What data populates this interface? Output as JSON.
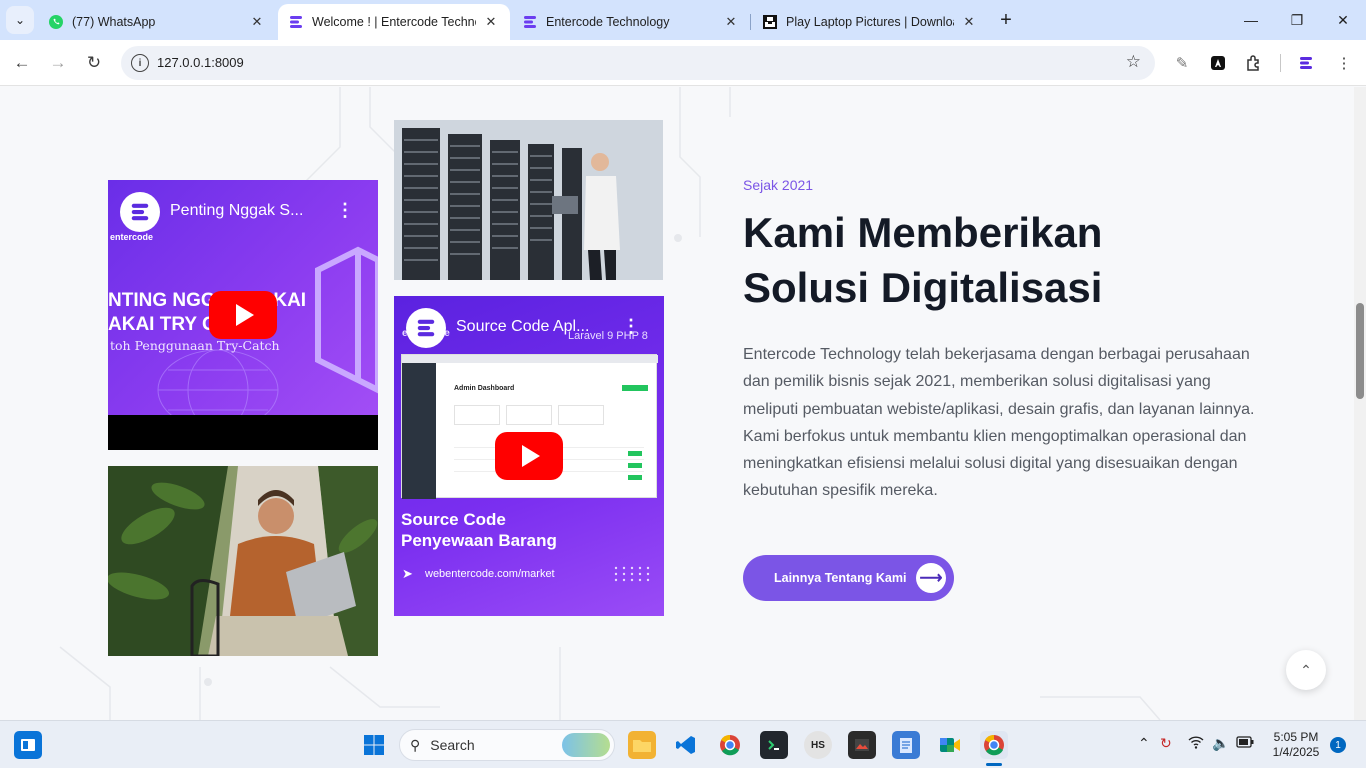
{
  "browser": {
    "tabs": [
      {
        "title": "(77) WhatsApp",
        "favicon": "whatsapp-icon"
      },
      {
        "title": "Welcome ! | Entercode Technology",
        "favicon": "entercode-icon",
        "active": true
      },
      {
        "title": "Entercode Technology",
        "favicon": "entercode-icon"
      },
      {
        "title": "Play Laptop Pictures | Download",
        "favicon": "unsplash-icon"
      }
    ],
    "url": "127.0.0.1:8009"
  },
  "videos": {
    "v1": {
      "title": "Penting Nggak S...",
      "brand": "entercode",
      "thumb_line1": "NTING NGGAK PAKAI",
      "thumb_line2": "AKAI TRY CATCH",
      "thumb_line3": "toh Penggunaan Try-Catch"
    },
    "v2": {
      "title": "Source Code Apl...",
      "brand": "entercode",
      "tag": "Laravel 9  PHP 8",
      "dashboard_title": "Admin Dashboard",
      "heading1": "Source Code",
      "heading2": "Penyewaan Barang",
      "site": "webentercode.com/market"
    }
  },
  "about": {
    "eyebrow": "Sejak 2021",
    "headline_line1": "Kami Memberikan",
    "headline_line2": "Solusi Digitalisasi",
    "body": "Entercode Technology telah bekerjasama dengan berbagai perusahaan dan pemilik bisnis sejak 2021, memberikan solusi digitalisasi yang meliputi pembuatan webiste/aplikasi, desain grafis, dan layanan lainnya. Kami berfokus untuk membantu klien mengoptimalkan operasional dan meningkatkan efisiensi melalui solusi digital yang disesuaikan dengan kebutuhan spesifik mereka.",
    "cta_label": "Lainnya Tentang Kami"
  },
  "taskbar": {
    "search_label": "Search",
    "time": "5:05 PM",
    "date": "1/4/2025",
    "notification_count": "1"
  },
  "colors": {
    "accent": "#7b55e6",
    "tabbar": "#d3e3fd",
    "headline": "#141a26"
  }
}
